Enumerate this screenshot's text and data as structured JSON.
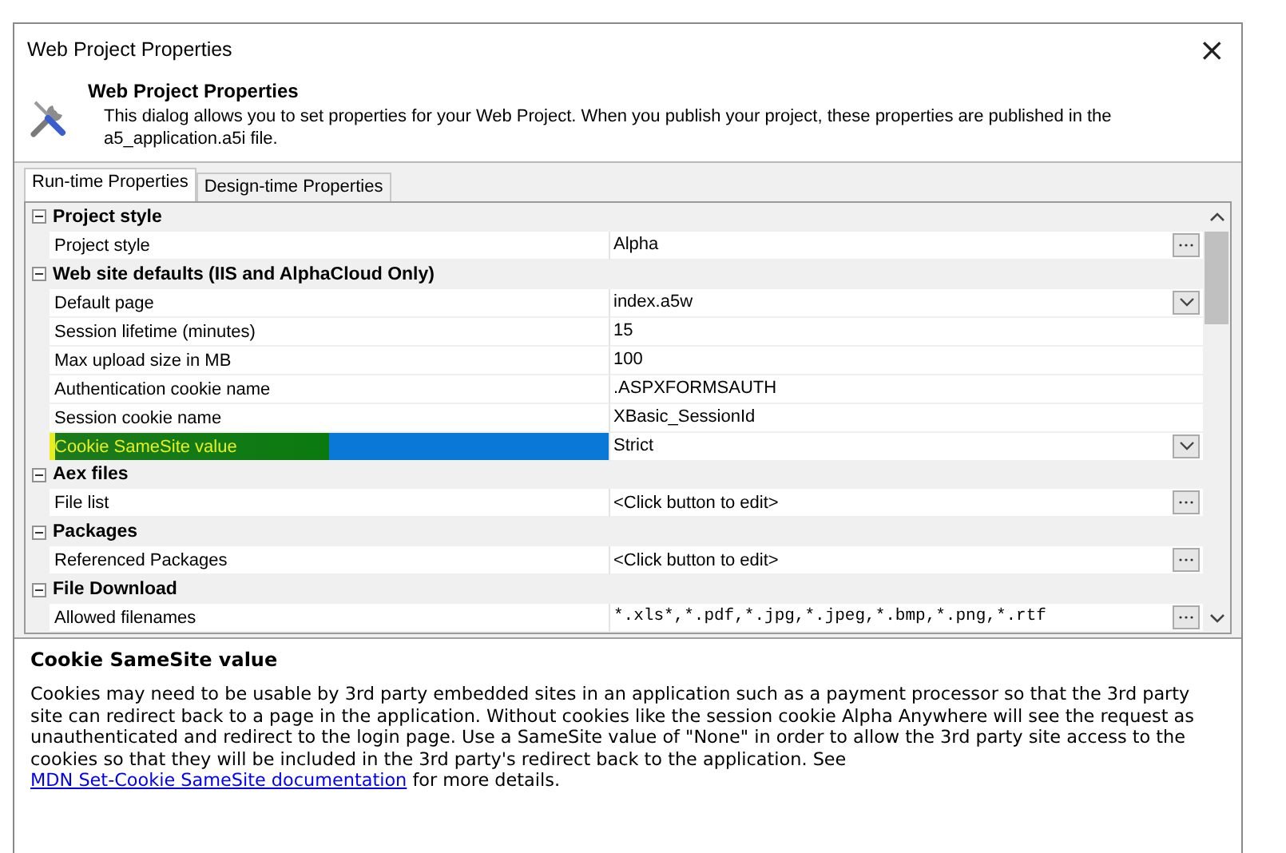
{
  "window": {
    "title": "Web Project Properties",
    "close": "×"
  },
  "header": {
    "title": "Web Project Properties",
    "description": "This dialog allows you to set properties for your Web Project. When you publish your project, these properties are published in the a5_application.a5i file."
  },
  "tabs": [
    {
      "label": "Run-time Properties",
      "selected": true
    },
    {
      "label": "Design-time Properties",
      "selected": false
    }
  ],
  "grid": {
    "sections": [
      {
        "title": "Project style",
        "expanded": true,
        "properties": [
          {
            "label": "Project style",
            "value": "Alpha",
            "kind": "editor",
            "selected": false
          }
        ]
      },
      {
        "title": "Web site defaults (IIS and AlphaCloud Only)",
        "expanded": true,
        "properties": [
          {
            "label": "Default page",
            "value": "index.a5w",
            "kind": "dropdown",
            "selected": false
          },
          {
            "label": "Session lifetime (minutes)",
            "value": "15",
            "kind": "text",
            "selected": false
          },
          {
            "label": "Max upload size in MB",
            "value": "100",
            "kind": "text",
            "selected": false
          },
          {
            "label": "Authentication cookie name",
            "value": ".ASPXFORMSAUTH",
            "kind": "text",
            "selected": false
          },
          {
            "label": "Session cookie name",
            "value": "XBasic_SessionId",
            "kind": "text",
            "selected": false
          },
          {
            "label": "Cookie SameSite value",
            "value": "Strict",
            "kind": "dropdown",
            "selected": true
          }
        ]
      },
      {
        "title": "Aex files",
        "expanded": true,
        "properties": [
          {
            "label": "File list",
            "value": "<Click button to edit>",
            "kind": "editor",
            "selected": false
          }
        ]
      },
      {
        "title": "Packages",
        "expanded": true,
        "properties": [
          {
            "label": "Referenced Packages",
            "value": "<Click button to edit>",
            "kind": "editor",
            "selected": false
          }
        ]
      },
      {
        "title": "File Download",
        "expanded": true,
        "properties": [
          {
            "label": "Allowed filenames",
            "value": "*.xls*,*.pdf,*.jpg,*.jpeg,*.bmp,*.png,*.rtf",
            "kind": "pattern-editor",
            "selected": false
          }
        ]
      }
    ]
  },
  "help": {
    "title": "Cookie SameSite value",
    "text_before": "Cookies may need to be usable by 3rd party embedded sites in an application such as a payment processor so that the 3rd party site can redirect back to a page in the application. Without cookies like the session cookie Alpha Anywhere will see the request as unauthenticated and redirect to the login page. Use a SameSite value of \"None\" in order to allow the 3rd party site access to the cookies so that they will be included in the 3rd party's redirect back to the application. See",
    "link": "MDN Set-Cookie SameSite documentation",
    "text_after": "for more details."
  }
}
